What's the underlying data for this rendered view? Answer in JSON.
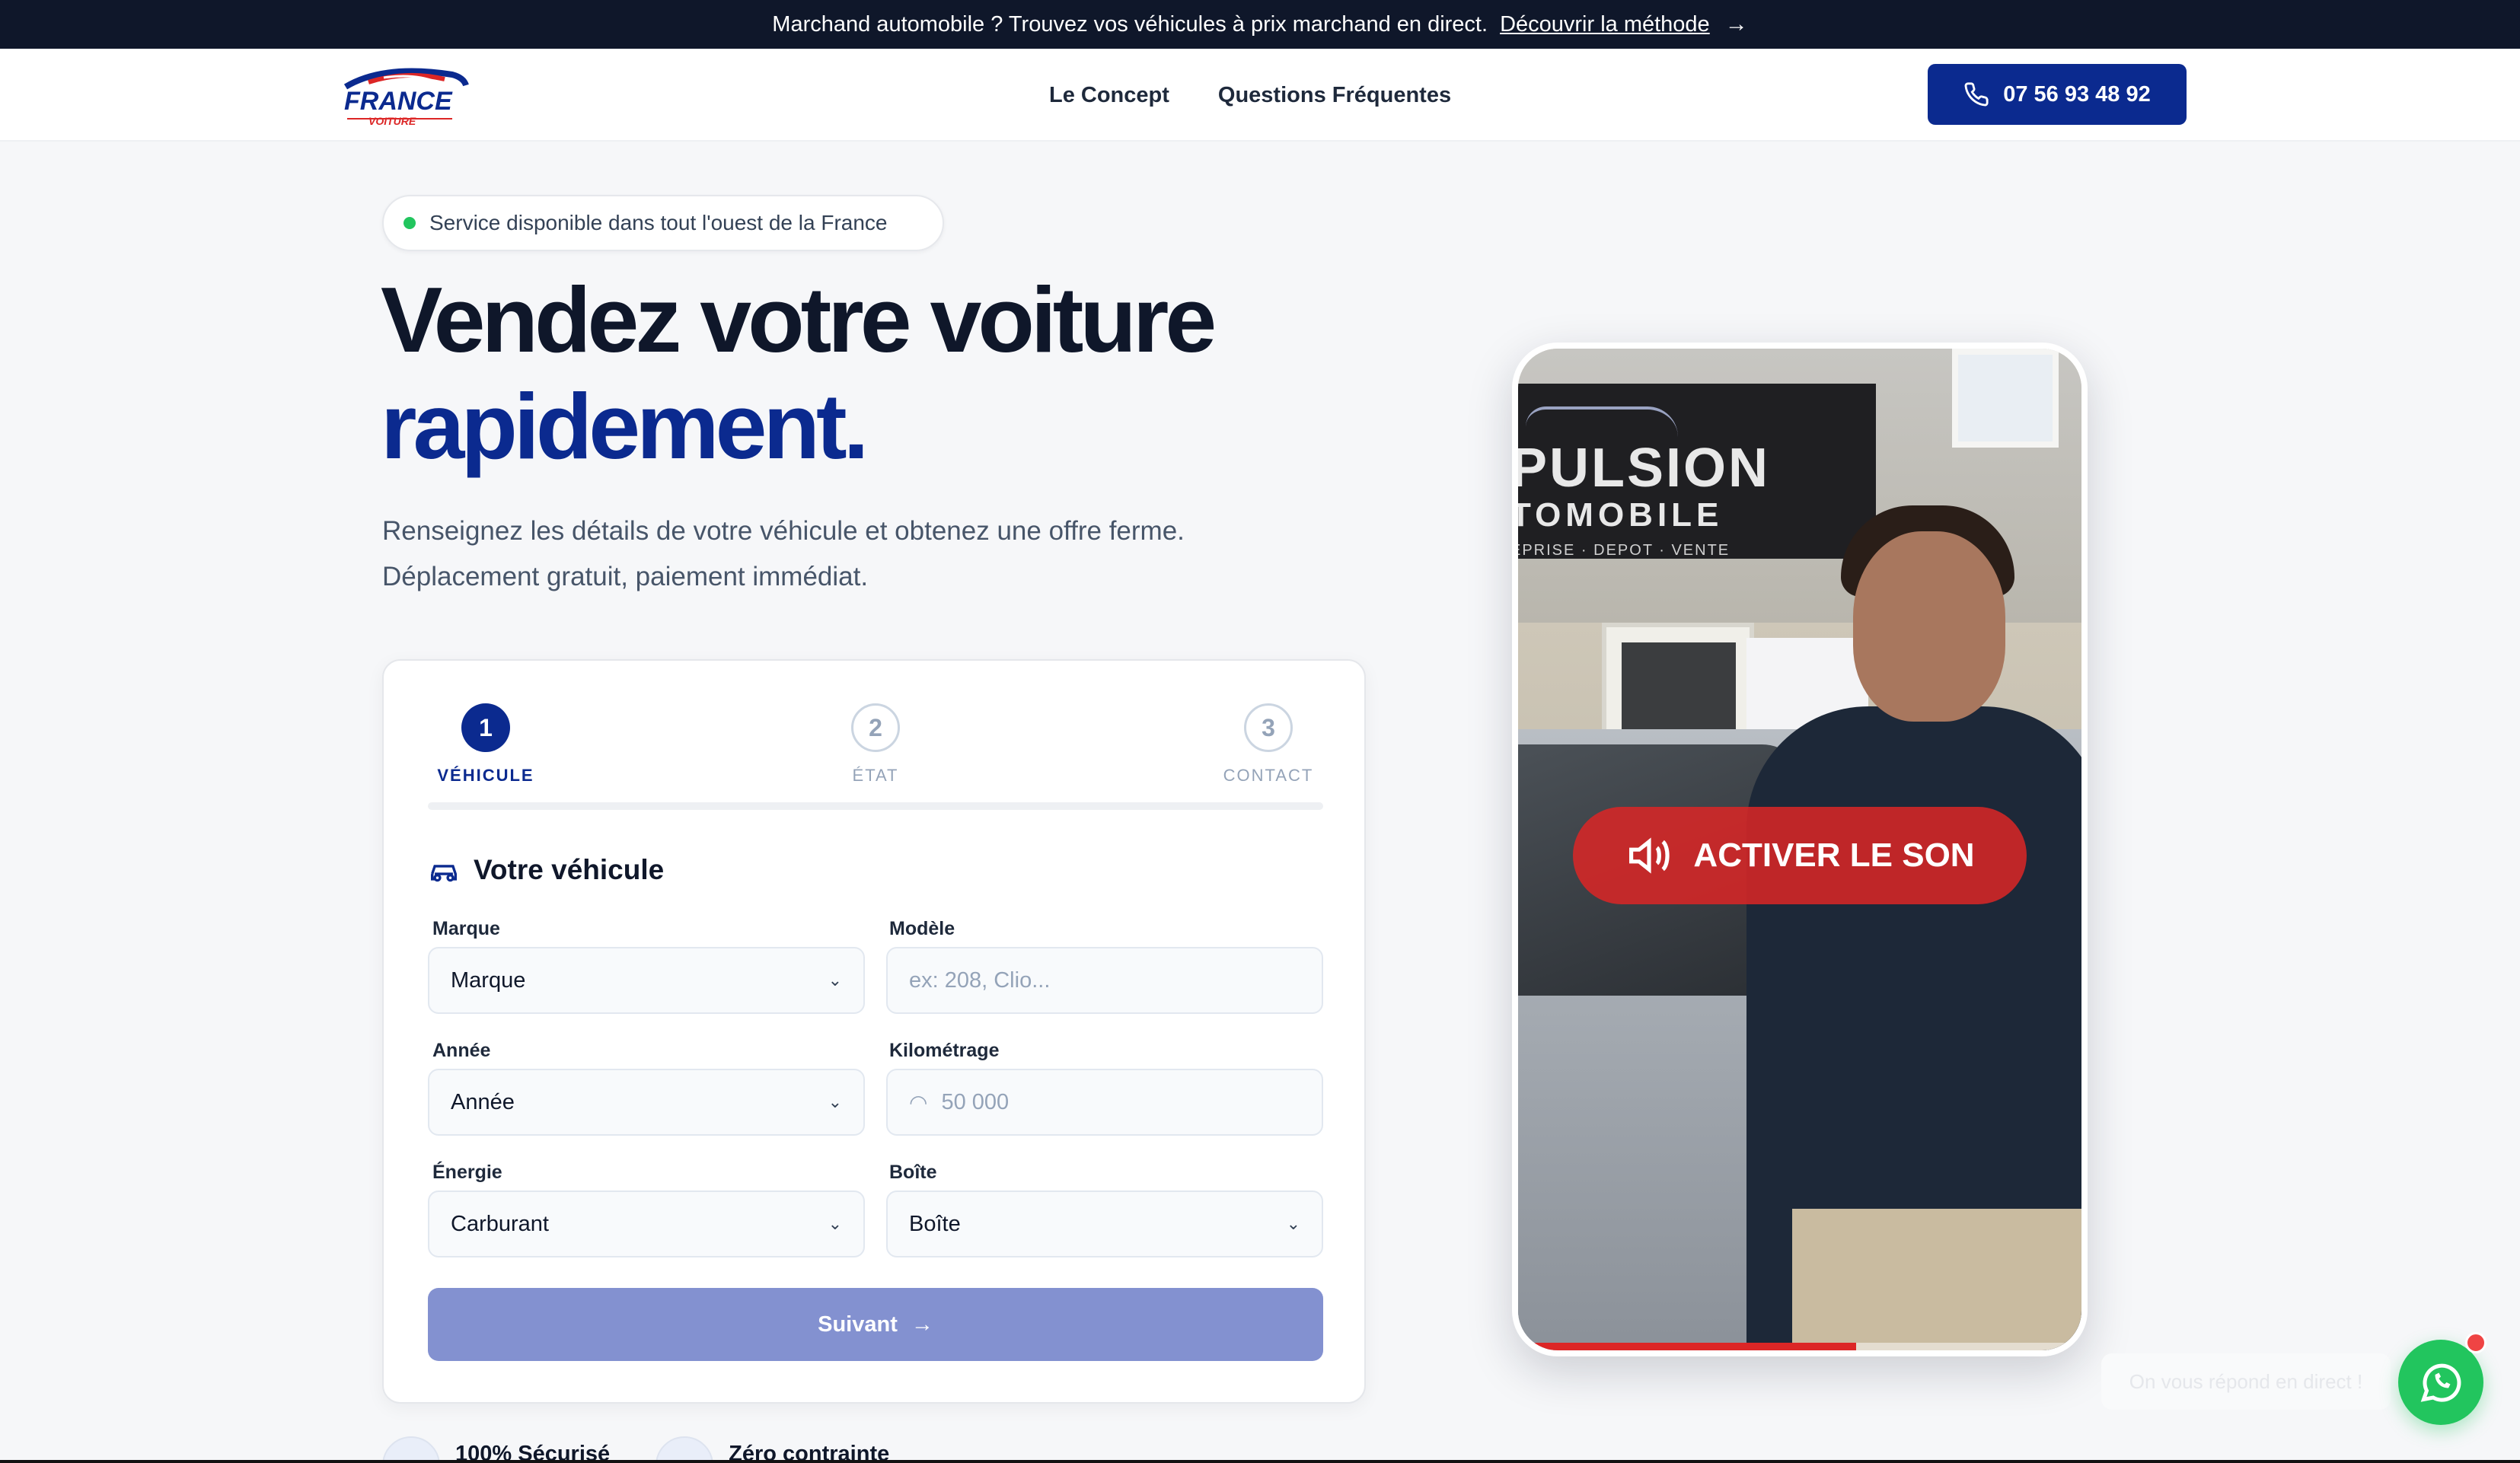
{
  "announcement": {
    "text": "Marchand automobile ? Trouvez vos véhicules à prix marchand en direct.",
    "link": "Découvrir la méthode"
  },
  "brand": {
    "name": "FRANCE",
    "sub": "VOITURE",
    "accent": "#0b2a8f",
    "red": "#dc2626"
  },
  "nav": {
    "links": [
      "Le Concept",
      "Questions Fréquentes"
    ],
    "phone": "07 56 93 48 92"
  },
  "hero": {
    "badge": "Service disponible dans tout l'ouest de la France",
    "title_line1": "Vendez votre voiture",
    "title_line2": "rapidement.",
    "subtitle_line1": "Renseignez les détails de votre véhicule et obtenez une offre ferme.",
    "subtitle_line2": "Déplacement gratuit, paiement immédiat."
  },
  "form": {
    "steps": [
      {
        "number": "1",
        "label": "VÉHICULE",
        "active": true
      },
      {
        "number": "2",
        "label": "ÉTAT",
        "active": false
      },
      {
        "number": "3",
        "label": "CONTACT",
        "active": false
      }
    ],
    "section_title": "Votre véhicule",
    "fields": {
      "marque": {
        "label": "Marque",
        "value": "Marque"
      },
      "modele": {
        "label": "Modèle",
        "placeholder": "ex: 208, Clio..."
      },
      "annee": {
        "label": "Année",
        "value": "Année"
      },
      "kilometrage": {
        "label": "Kilométrage",
        "placeholder": "50 000"
      },
      "energie": {
        "label": "Énergie",
        "value": "Carburant"
      },
      "boite": {
        "label": "Boîte",
        "value": "Boîte"
      }
    },
    "next_label": "Suivant"
  },
  "features": [
    {
      "label": "100% Sécurisé"
    },
    {
      "label": "Zéro contrainte"
    }
  ],
  "video": {
    "sound_label": "ACTIVER LE SON",
    "sign_line1": "PULSION",
    "sign_line2": "TOMOBILE",
    "sign_line3": "EPRISE · DEPOT · VENTE",
    "progress": 0.6
  },
  "whatsapp": {
    "tooltip": "On vous répond en direct !"
  }
}
